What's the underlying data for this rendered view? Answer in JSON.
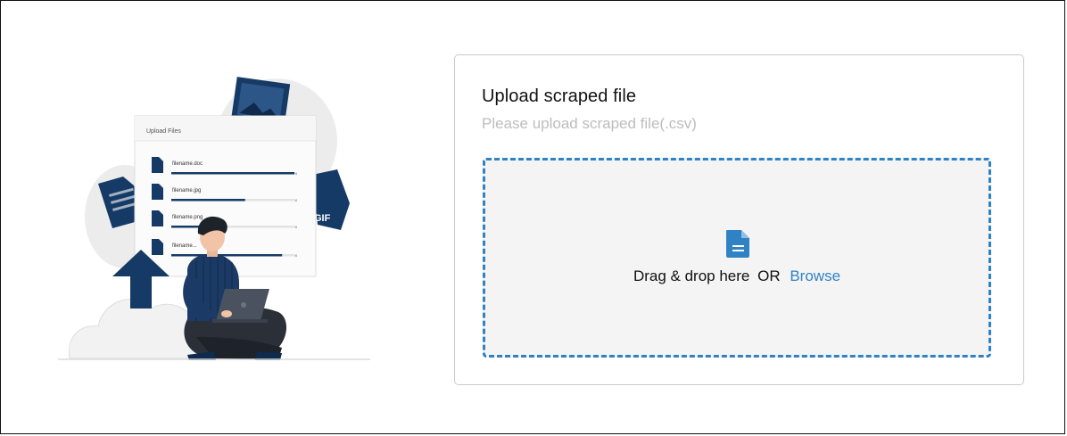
{
  "illustration": {
    "panel_title": "Upload Files",
    "files": [
      "filename.doc",
      "filename.jpg",
      "filename.png",
      "filename..."
    ],
    "progress": [
      1.0,
      0.6,
      0.35,
      0.9
    ],
    "badge": "GIF"
  },
  "upload": {
    "title": "Upload scraped file",
    "subtitle": "Please upload scraped file(.csv)",
    "drop_text": "Drag & drop here",
    "or_text": "OR",
    "browse_label": "Browse"
  },
  "colors": {
    "accent": "#2f82c4",
    "navy": "#163a66",
    "dropzone_bg": "#f4f4f4"
  },
  "icons": {
    "drop": "file-icon",
    "upload_arrow": "upload-arrow-icon"
  }
}
